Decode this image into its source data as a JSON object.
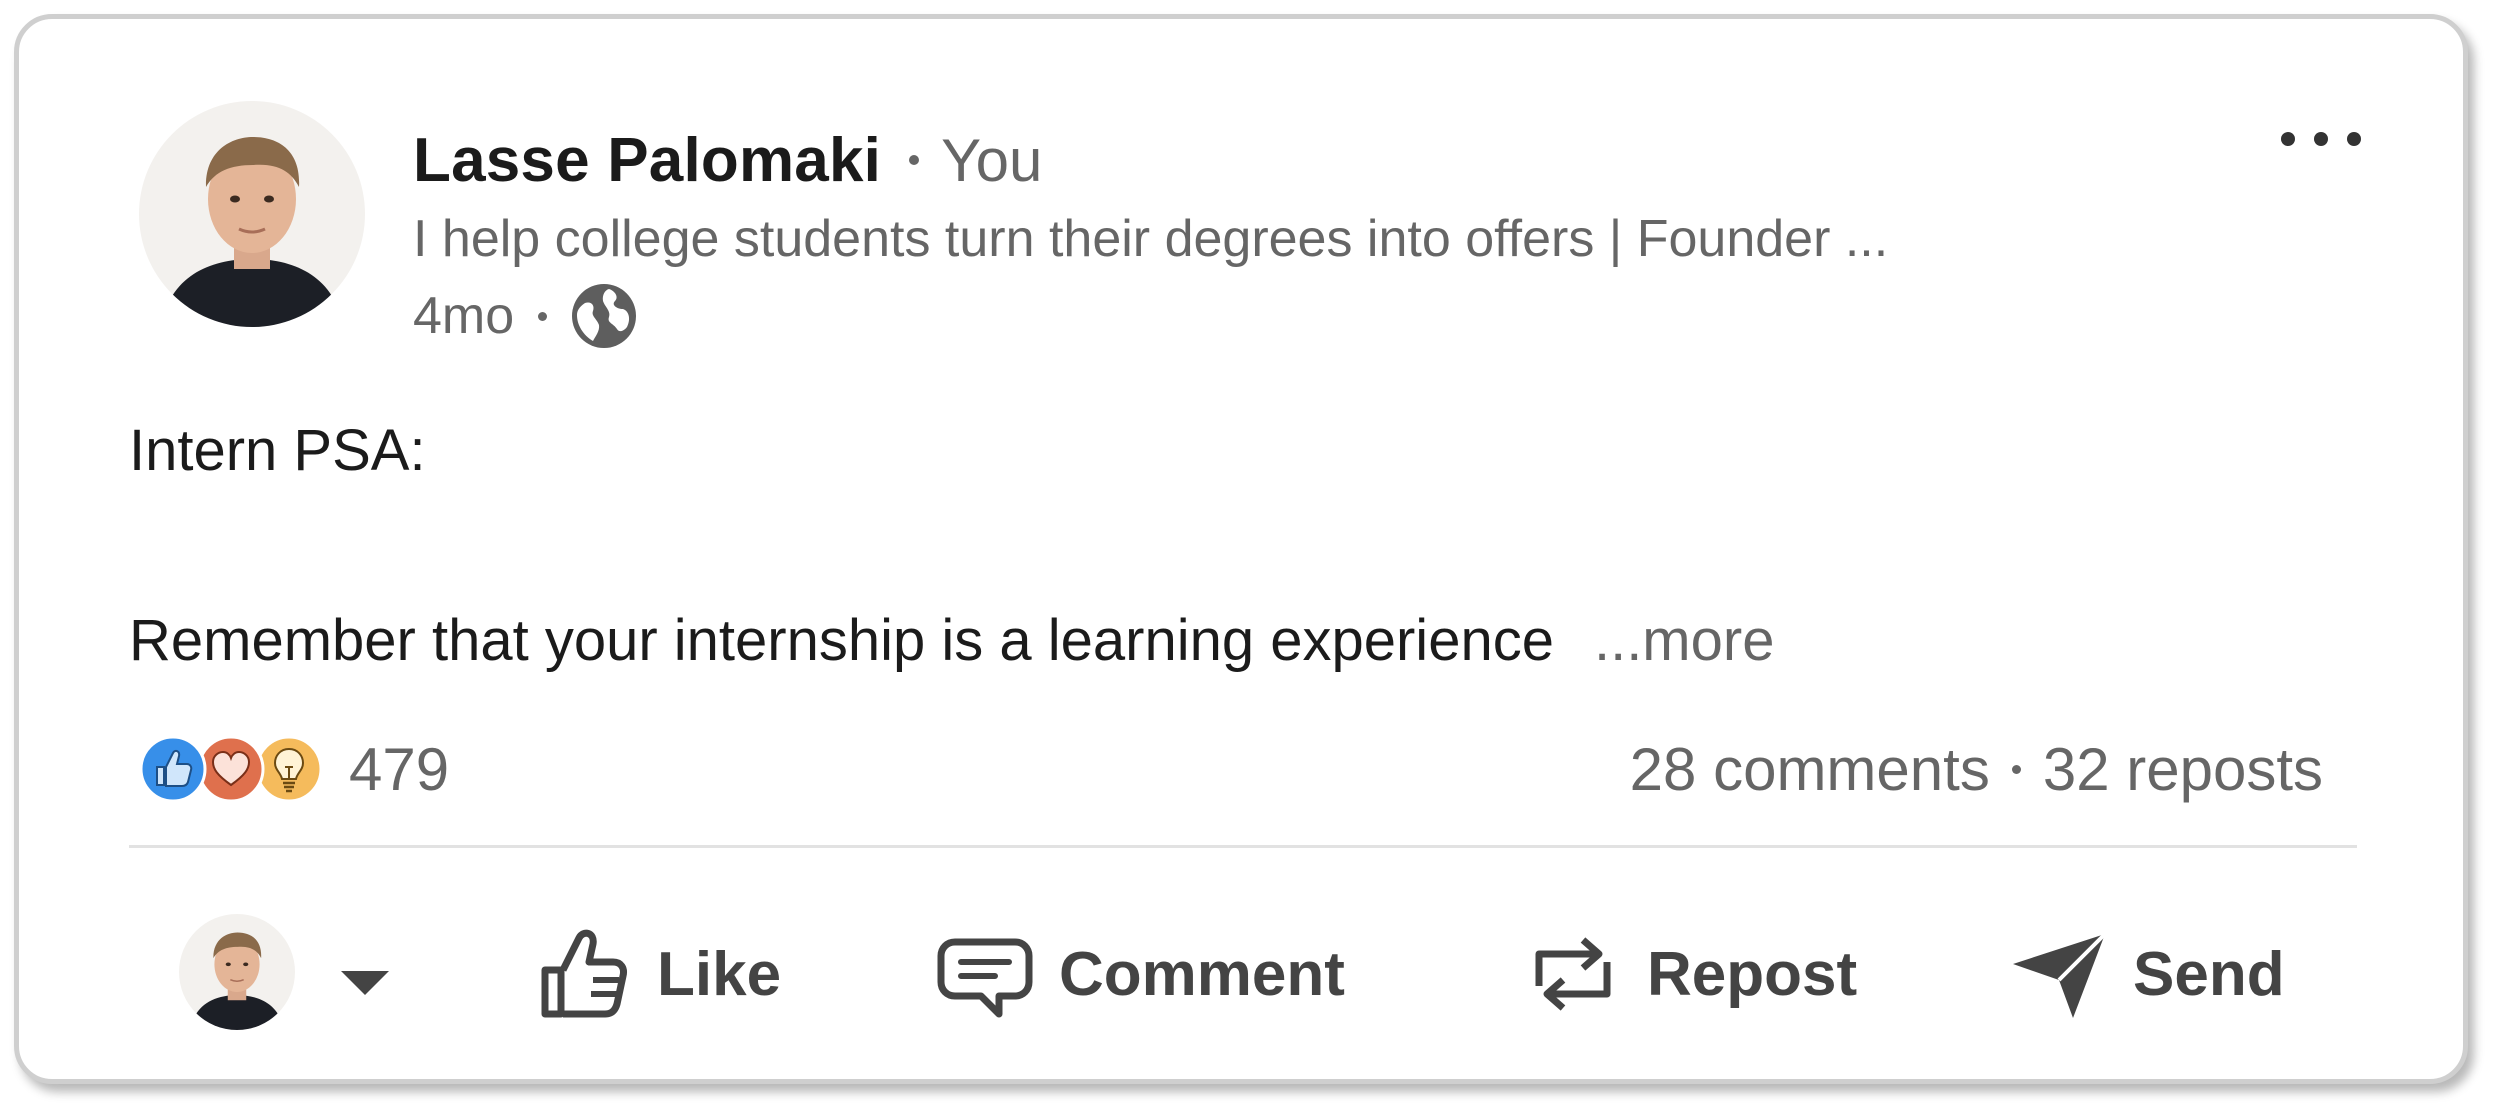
{
  "post": {
    "author": {
      "name": "Lasse Palomaki",
      "connection_degree": "You",
      "headline": "I help college students turn their degrees into offers | Founder ...",
      "time_ago": "4mo",
      "visibility_icon": "globe-icon"
    },
    "body": {
      "line1": "Intern PSA:",
      "line2": "Remember that your internship is a learning experience",
      "see_more": "...more"
    },
    "reactions": {
      "icons": [
        "like-reaction-icon",
        "love-reaction-icon",
        "insightful-reaction-icon"
      ],
      "count": "479"
    },
    "social": {
      "comments": "28 comments",
      "reposts": "32 reposts"
    },
    "actions": {
      "like": "Like",
      "comment": "Comment",
      "repost": "Repost",
      "send": "Send"
    },
    "colors": {
      "like_blue": "#378fe9",
      "love_red": "#df704d",
      "insight_yellow": "#f5bb5c",
      "text_primary": "#1b1b1b",
      "text_secondary": "#666666"
    }
  }
}
